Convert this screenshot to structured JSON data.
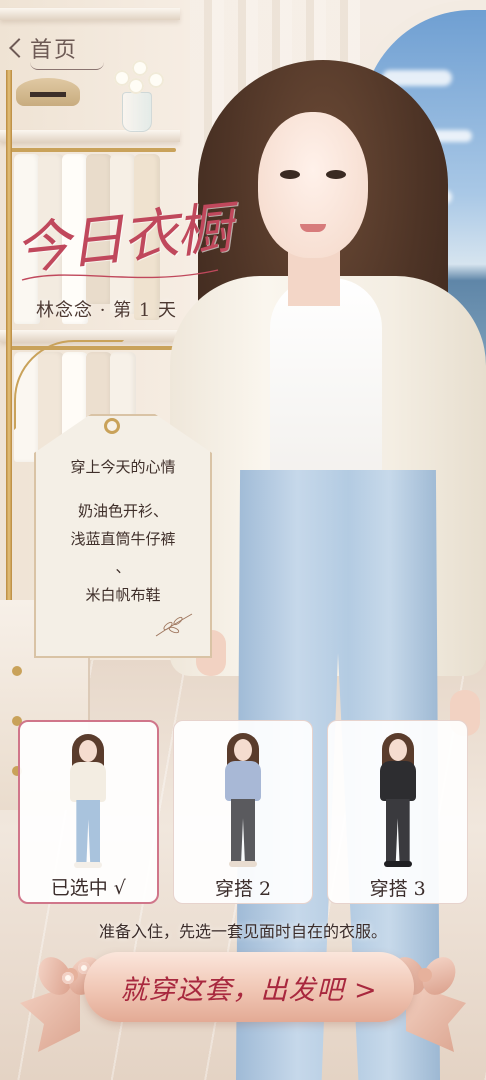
{
  "nav": {
    "back_label": "首页"
  },
  "title": {
    "logo_text": "今日衣橱",
    "subtitle": "林念念 · 第 1 天"
  },
  "mood_tag": {
    "heading": "穿上今天的心情",
    "lines": [
      "奶油色开衫、",
      "浅蓝直筒牛仔裤",
      "、",
      "米白帆布鞋"
    ]
  },
  "outfits": [
    {
      "label": "已选中 √",
      "selected": true,
      "top_color": "#f3ede2",
      "pants_color": "#a9c3dd",
      "shoes_color": "#f4efe8"
    },
    {
      "label": "穿搭 2",
      "selected": false,
      "top_color": "#a8b8d6",
      "pants_color": "#5a5a5e",
      "shoes_color": "#e8dcd0"
    },
    {
      "label": "穿搭 3",
      "selected": false,
      "top_color": "#2d2d30",
      "pants_color": "#3a3a3e",
      "shoes_color": "#1f1f22"
    }
  ],
  "hint": "准备入住，先选一套见面时自在的衣服。",
  "cta": {
    "label": "就穿这套，出发吧 >"
  },
  "colors": {
    "accent": "#c0485c",
    "cta_text": "#a8283e",
    "gold": "#c9a25a",
    "selected_border": "#d0768a"
  }
}
